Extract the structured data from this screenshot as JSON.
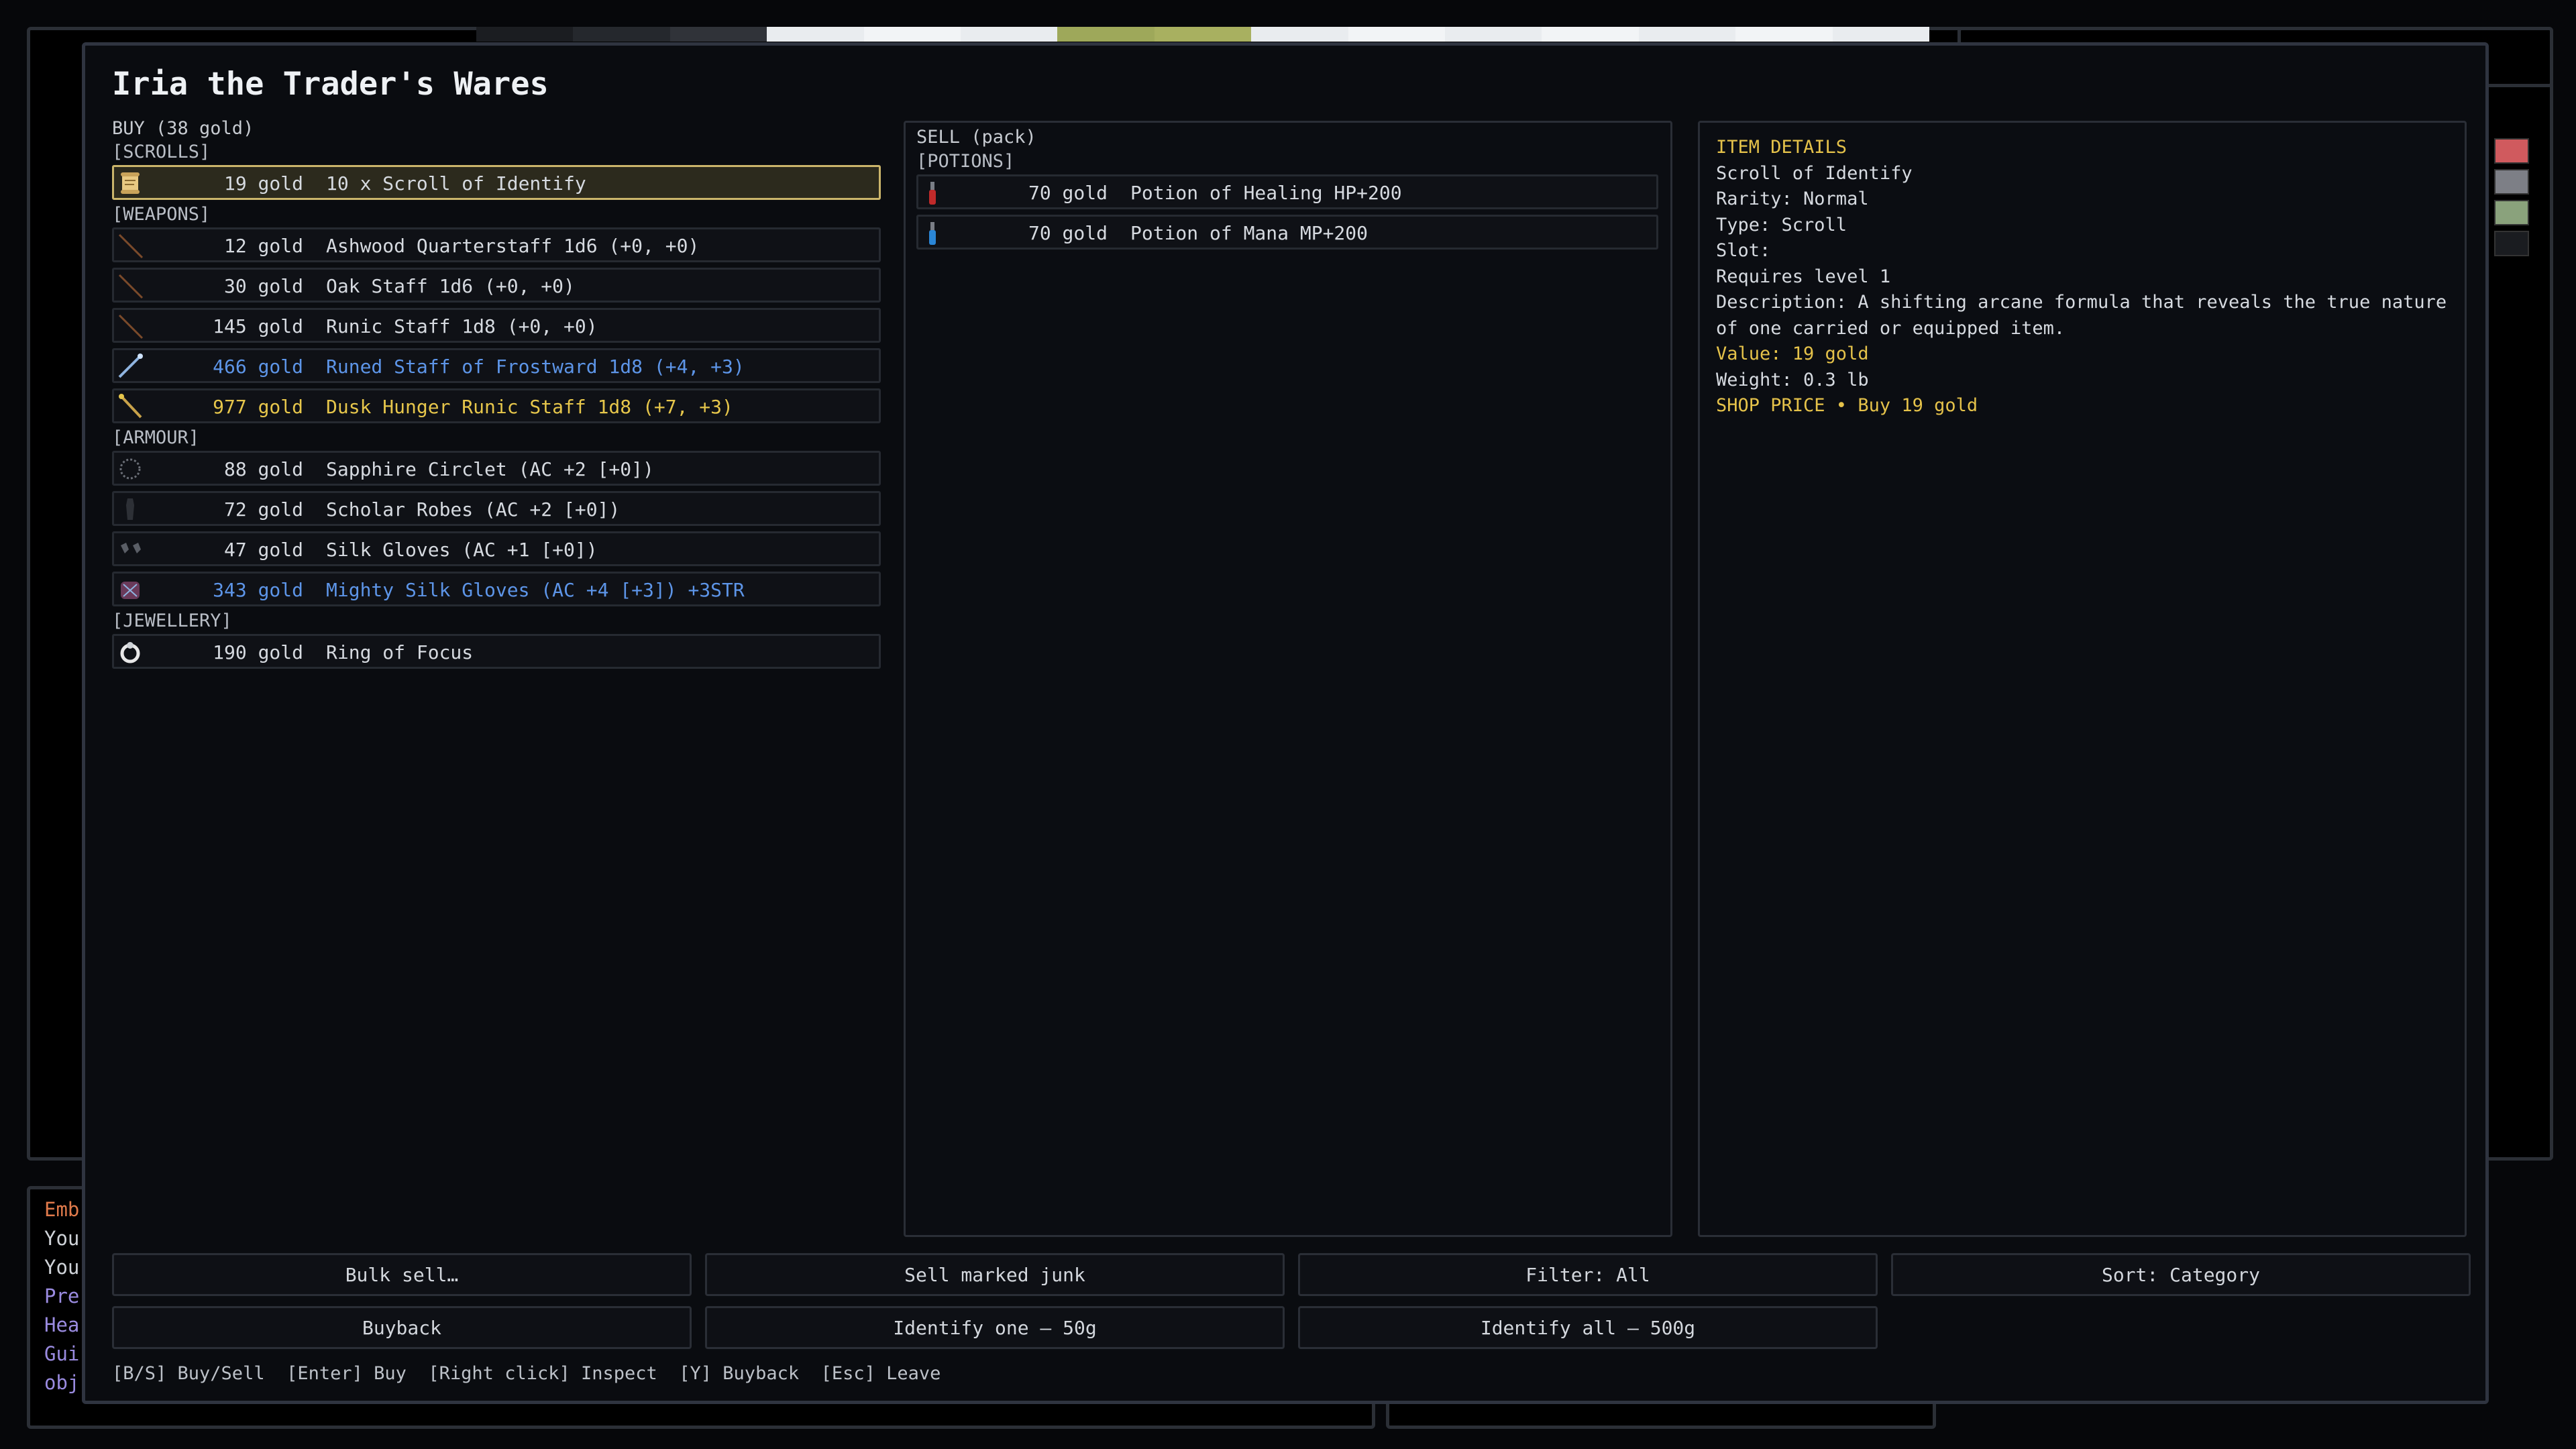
{
  "game_log": {
    "lines": [
      "Emb",
      "You",
      "You",
      "Pre",
      "Hea",
      "Gui",
      "obj"
    ],
    "line_colors": [
      "#e07a4b",
      "#cfd3d8",
      "#cfd3d8",
      "#9a8be0",
      "#9a8be0",
      "#9a8be0",
      "#9a8be0"
    ]
  },
  "status_swatches": [
    "#d05a5e",
    "#7d7f86",
    "#8aa27c",
    "#1a1c20"
  ],
  "shop": {
    "title": "Iria the Trader's Wares",
    "buy": {
      "header": "BUY  (38 gold)",
      "categories": [
        {
          "label": "[SCROLLS]",
          "items": [
            {
              "price": "19 gold",
              "name": "10 x Scroll of Identify",
              "rarity": "normal",
              "icon": "scroll-icon",
              "selected": true
            }
          ]
        },
        {
          "label": "[WEAPONS]",
          "items": [
            {
              "price": "12 gold",
              "name": "Ashwood Quarterstaff 1d6 (+0, +0)",
              "rarity": "normal",
              "icon": "staff-icon"
            },
            {
              "price": "30 gold",
              "name": "Oak Staff 1d6 (+0, +0)",
              "rarity": "normal",
              "icon": "staff-icon"
            },
            {
              "price": "145 gold",
              "name": "Runic Staff 1d8 (+0, +0)",
              "rarity": "normal",
              "icon": "staff-icon"
            },
            {
              "price": "466 gold",
              "name": "Runed Staff of Frostward 1d8 (+4, +3)",
              "rarity": "magic",
              "icon": "frost-staff-icon"
            },
            {
              "price": "977 gold",
              "name": "Dusk Hunger Runic Staff 1d8 (+7, +3)",
              "rarity": "rare",
              "icon": "golden-staff-icon"
            }
          ]
        },
        {
          "label": "[ARMOUR]",
          "items": [
            {
              "price": "88 gold",
              "name": "Sapphire Circlet (AC +2 [+0])",
              "rarity": "normal",
              "icon": "circlet-icon"
            },
            {
              "price": "72 gold",
              "name": "Scholar Robes (AC +2 [+0])",
              "rarity": "normal",
              "icon": "robe-icon"
            },
            {
              "price": "47 gold",
              "name": "Silk Gloves (AC +1 [+0])",
              "rarity": "normal",
              "icon": "gloves-icon"
            },
            {
              "price": "343 gold",
              "name": "Mighty Silk Gloves (AC +4 [+3]) +3STR",
              "rarity": "magic",
              "icon": "mighty-gloves-icon"
            }
          ]
        },
        {
          "label": "[JEWELLERY]",
          "items": [
            {
              "price": "190 gold",
              "name": "Ring of Focus",
              "rarity": "normal",
              "icon": "ring-icon"
            }
          ]
        }
      ]
    },
    "sell": {
      "header": "SELL  (pack)",
      "categories": [
        {
          "label": "[POTIONS]",
          "items": [
            {
              "price": "70 gold",
              "name": "Potion of Healing HP+200",
              "rarity": "normal",
              "icon": "red-potion-icon"
            },
            {
              "price": "70 gold",
              "name": "Potion of Mana MP+200",
              "rarity": "normal",
              "icon": "blue-potion-icon"
            }
          ]
        }
      ]
    },
    "details": {
      "header": "ITEM DETAILS",
      "name": "Scroll of Identify",
      "rarity": "Rarity: Normal",
      "type": "Type: Scroll",
      "slot": "Slot:",
      "requires": "Requires level 1",
      "description_1": "Description: A shifting arcane formula that reveals the true nature",
      "description_2": "of one carried or equipped item.",
      "value": "Value: 19 gold",
      "weight": "Weight: 0.3 lb",
      "shop_price": "SHOP PRICE • Buy 19 gold"
    },
    "buttons": {
      "bulk_sell": "Bulk sell…",
      "sell_junk": "Sell marked junk",
      "filter": "Filter: All",
      "sort": "Sort: Category",
      "buyback": "Buyback",
      "identify_one": "Identify one — 50g",
      "identify_all": "Identify all — 500g"
    },
    "hints": "[B/S] Buy/Sell  [Enter] Buy  [Right click] Inspect  [Y] Buyback  [Esc] Leave"
  },
  "colors": {
    "normal": "#d6dae0",
    "magic": "#5d95e8",
    "rare": "#e6c64b",
    "detail_header": "#e5c24a",
    "selection_border": "#cbb56b"
  }
}
